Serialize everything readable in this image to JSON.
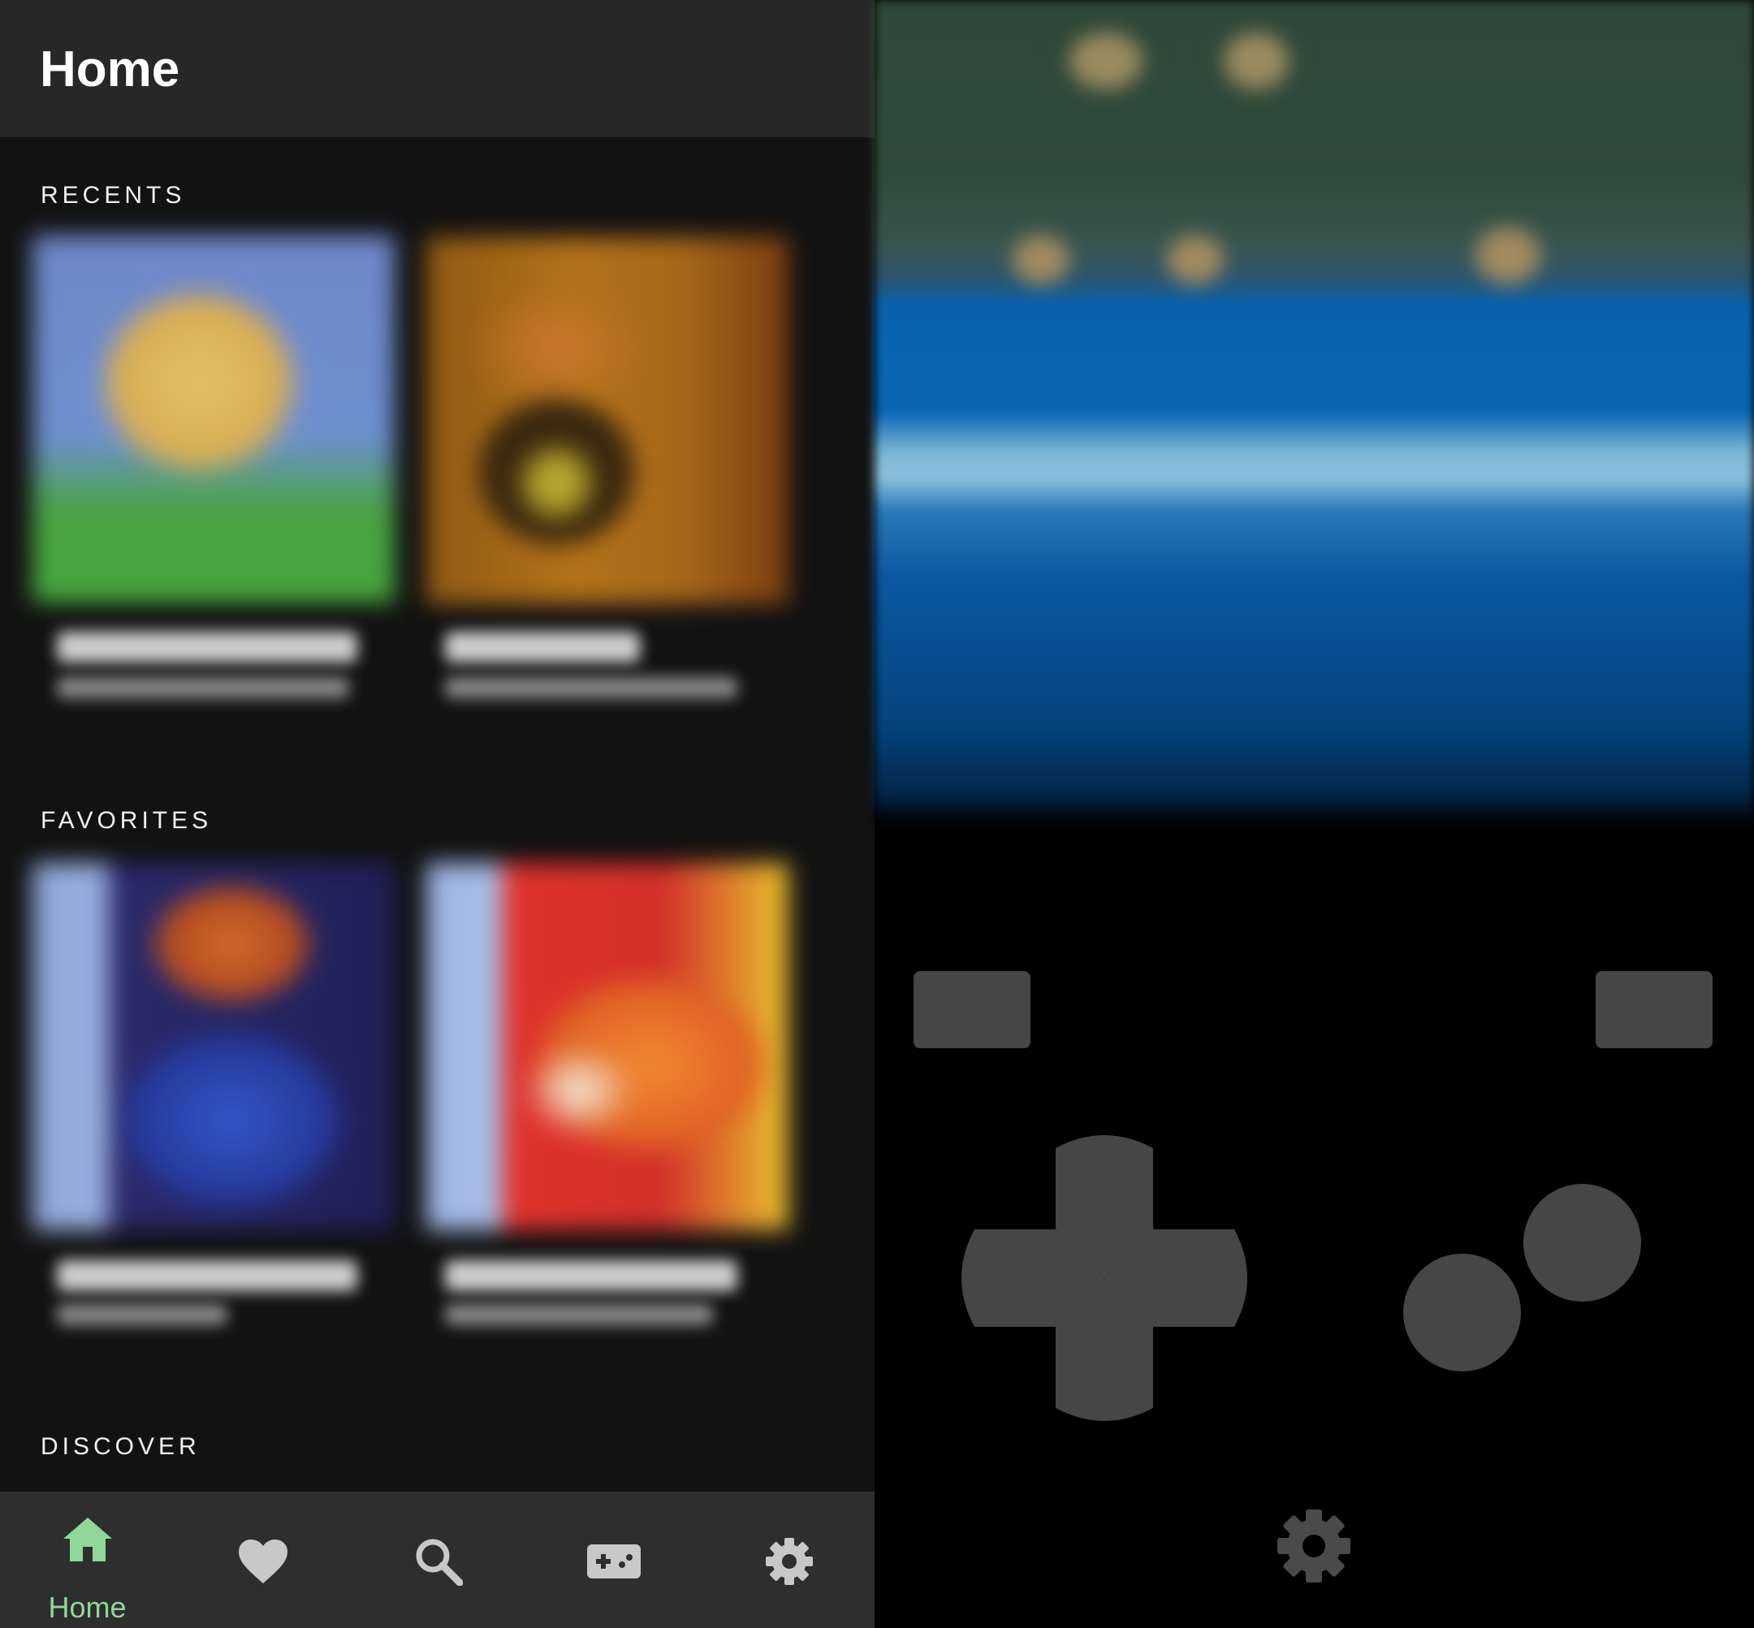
{
  "library": {
    "title": "Home",
    "sections": {
      "recents": "RECENTS",
      "favorites": "FAVORITES",
      "discover": "DISCOVER"
    }
  },
  "bottom_nav": {
    "active": "home",
    "items": [
      {
        "id": "home",
        "label": "Home",
        "icon": "home-icon"
      },
      {
        "id": "favorites",
        "icon": "heart-icon"
      },
      {
        "id": "search",
        "icon": "search-icon"
      },
      {
        "id": "systems",
        "icon": "gamepad-icon"
      },
      {
        "id": "settings",
        "icon": "gear-icon"
      }
    ]
  },
  "emulator": {
    "controls": [
      "select-button",
      "start-button",
      "dpad-up",
      "dpad-down",
      "dpad-left",
      "dpad-right",
      "a-button",
      "b-button",
      "emulator-menu-gear-icon"
    ]
  },
  "colors": {
    "topbar": "#272727",
    "background": "#121212",
    "nav_background": "#2e2e2e",
    "accent": "#8fd898",
    "nav_icon": "#c8c8c8",
    "controls": "#464646",
    "menu_gear": "#4a4a4a"
  }
}
